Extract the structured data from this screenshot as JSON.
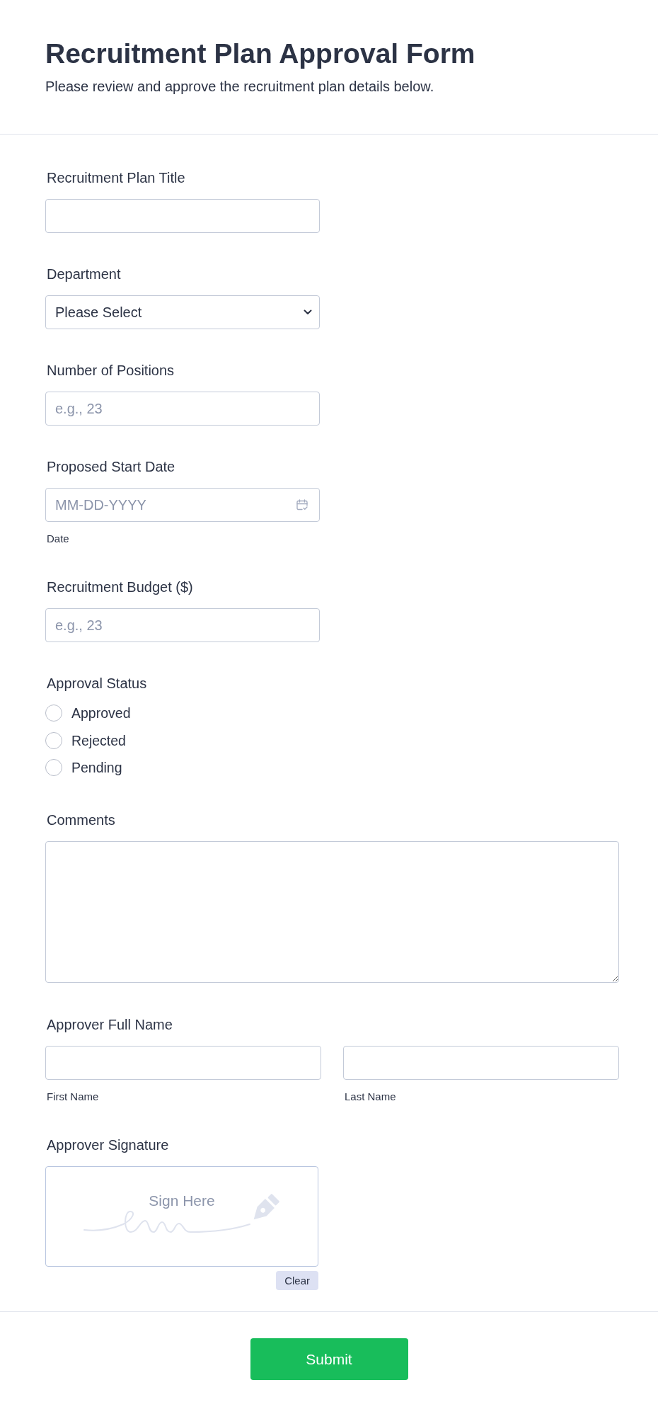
{
  "header": {
    "title": "Recruitment Plan Approval Form",
    "subtitle": "Please review and approve the recruitment plan details below."
  },
  "fields": [
    {
      "kind": "text",
      "label": "Recruitment Plan Title"
    },
    {
      "kind": "select",
      "label": "Department",
      "value": "Please Select"
    },
    {
      "kind": "text",
      "label": "Number of Positions",
      "placeholder": "e.g., 23"
    },
    {
      "kind": "date",
      "label": "Proposed Start Date",
      "placeholder": "MM-DD-YYYY",
      "sublabel": "Date"
    },
    {
      "kind": "text",
      "label": "Recruitment Budget ($)",
      "placeholder": "e.g., 23"
    },
    {
      "kind": "radio",
      "label": "Approval Status",
      "options": [
        {
          "label": "Approved",
          "selected": false
        },
        {
          "label": "Rejected",
          "selected": false
        },
        {
          "label": "Pending",
          "selected": false
        }
      ]
    },
    {
      "kind": "textarea",
      "label": "Comments"
    },
    {
      "kind": "name",
      "label": "Approver Full Name",
      "parts": [
        {
          "sublabel": "First Name"
        },
        {
          "sublabel": "Last Name"
        }
      ]
    },
    {
      "kind": "signature",
      "label": "Approver Signature",
      "prompt": "Sign Here",
      "clear_button": "Clear"
    }
  ],
  "submit_button": "Submit"
}
